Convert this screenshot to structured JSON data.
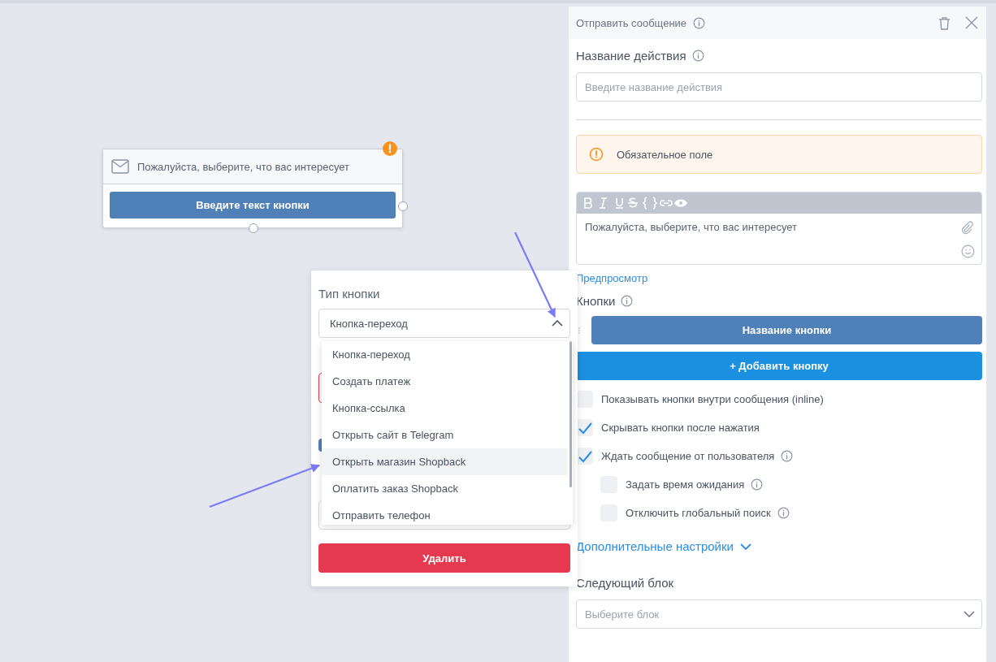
{
  "node": {
    "message": "Пожалуйста, выберите, что вас интересует",
    "button": "Введите текст кнопки",
    "warning": true
  },
  "button_popup": {
    "title": "Тип кнопки",
    "select": {
      "value": "Кнопка-переход",
      "expanded": true
    },
    "options": [
      {
        "label": "Кнопка-переход",
        "selected": false
      },
      {
        "label": "Создать платеж",
        "selected": false
      },
      {
        "label": "Кнопка-ссылка",
        "selected": false
      },
      {
        "label": "Открыть сайт в Telegram",
        "selected": false
      },
      {
        "label": "Открыть магазин Shopback",
        "selected": true
      },
      {
        "label": "Оплатить заказ Shopback",
        "selected": false
      },
      {
        "label": "Отправить телефон",
        "selected": false
      }
    ],
    "delete_button": "Удалить"
  },
  "panel": {
    "title": "Отправить сообщение",
    "action_name_label": "Название действия",
    "action_name_placeholder": "Введите название действия",
    "alert": "Обязательное поле",
    "editor_text": "Пожалуйста, выберите, что вас интересует",
    "preview_link": "Предпросмотр",
    "buttons_label": "Кнопки",
    "buttons": [
      {
        "label": "Название кнопки"
      }
    ],
    "add_button": "+ Добавить кнопку",
    "options": [
      {
        "label": "Показывать кнопки внутри сообщения (inline)",
        "checked": false,
        "info": false
      },
      {
        "label": "Скрывать кнопки после нажатия",
        "checked": true,
        "info": false
      },
      {
        "label": "Ждать сообщение от пользователя",
        "checked": true,
        "info": true,
        "children": [
          {
            "label": "Задать время ожидания",
            "checked": false,
            "info": true
          },
          {
            "label": "Отключить глобальный поиск",
            "checked": false,
            "info": true
          }
        ]
      }
    ],
    "advanced": "Дополнительные настройки",
    "next_block_label": "Следующий блок",
    "next_block_placeholder": "Выберите блок"
  }
}
